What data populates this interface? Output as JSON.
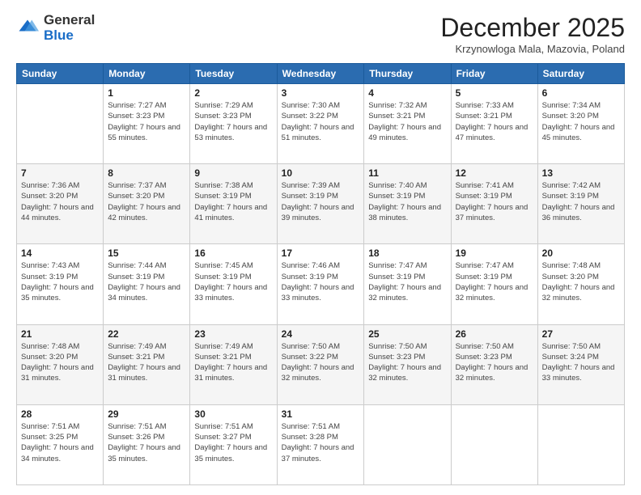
{
  "logo": {
    "general": "General",
    "blue": "Blue"
  },
  "header": {
    "month": "December 2025",
    "location": "Krzynowloga Mala, Mazovia, Poland"
  },
  "days_header": [
    "Sunday",
    "Monday",
    "Tuesday",
    "Wednesday",
    "Thursday",
    "Friday",
    "Saturday"
  ],
  "weeks": [
    [
      {
        "day": "",
        "sunrise": "",
        "sunset": "",
        "daylight": ""
      },
      {
        "day": "1",
        "sunrise": "Sunrise: 7:27 AM",
        "sunset": "Sunset: 3:23 PM",
        "daylight": "Daylight: 7 hours and 55 minutes."
      },
      {
        "day": "2",
        "sunrise": "Sunrise: 7:29 AM",
        "sunset": "Sunset: 3:23 PM",
        "daylight": "Daylight: 7 hours and 53 minutes."
      },
      {
        "day": "3",
        "sunrise": "Sunrise: 7:30 AM",
        "sunset": "Sunset: 3:22 PM",
        "daylight": "Daylight: 7 hours and 51 minutes."
      },
      {
        "day": "4",
        "sunrise": "Sunrise: 7:32 AM",
        "sunset": "Sunset: 3:21 PM",
        "daylight": "Daylight: 7 hours and 49 minutes."
      },
      {
        "day": "5",
        "sunrise": "Sunrise: 7:33 AM",
        "sunset": "Sunset: 3:21 PM",
        "daylight": "Daylight: 7 hours and 47 minutes."
      },
      {
        "day": "6",
        "sunrise": "Sunrise: 7:34 AM",
        "sunset": "Sunset: 3:20 PM",
        "daylight": "Daylight: 7 hours and 45 minutes."
      }
    ],
    [
      {
        "day": "7",
        "sunrise": "Sunrise: 7:36 AM",
        "sunset": "Sunset: 3:20 PM",
        "daylight": "Daylight: 7 hours and 44 minutes."
      },
      {
        "day": "8",
        "sunrise": "Sunrise: 7:37 AM",
        "sunset": "Sunset: 3:20 PM",
        "daylight": "Daylight: 7 hours and 42 minutes."
      },
      {
        "day": "9",
        "sunrise": "Sunrise: 7:38 AM",
        "sunset": "Sunset: 3:19 PM",
        "daylight": "Daylight: 7 hours and 41 minutes."
      },
      {
        "day": "10",
        "sunrise": "Sunrise: 7:39 AM",
        "sunset": "Sunset: 3:19 PM",
        "daylight": "Daylight: 7 hours and 39 minutes."
      },
      {
        "day": "11",
        "sunrise": "Sunrise: 7:40 AM",
        "sunset": "Sunset: 3:19 PM",
        "daylight": "Daylight: 7 hours and 38 minutes."
      },
      {
        "day": "12",
        "sunrise": "Sunrise: 7:41 AM",
        "sunset": "Sunset: 3:19 PM",
        "daylight": "Daylight: 7 hours and 37 minutes."
      },
      {
        "day": "13",
        "sunrise": "Sunrise: 7:42 AM",
        "sunset": "Sunset: 3:19 PM",
        "daylight": "Daylight: 7 hours and 36 minutes."
      }
    ],
    [
      {
        "day": "14",
        "sunrise": "Sunrise: 7:43 AM",
        "sunset": "Sunset: 3:19 PM",
        "daylight": "Daylight: 7 hours and 35 minutes."
      },
      {
        "day": "15",
        "sunrise": "Sunrise: 7:44 AM",
        "sunset": "Sunset: 3:19 PM",
        "daylight": "Daylight: 7 hours and 34 minutes."
      },
      {
        "day": "16",
        "sunrise": "Sunrise: 7:45 AM",
        "sunset": "Sunset: 3:19 PM",
        "daylight": "Daylight: 7 hours and 33 minutes."
      },
      {
        "day": "17",
        "sunrise": "Sunrise: 7:46 AM",
        "sunset": "Sunset: 3:19 PM",
        "daylight": "Daylight: 7 hours and 33 minutes."
      },
      {
        "day": "18",
        "sunrise": "Sunrise: 7:47 AM",
        "sunset": "Sunset: 3:19 PM",
        "daylight": "Daylight: 7 hours and 32 minutes."
      },
      {
        "day": "19",
        "sunrise": "Sunrise: 7:47 AM",
        "sunset": "Sunset: 3:19 PM",
        "daylight": "Daylight: 7 hours and 32 minutes."
      },
      {
        "day": "20",
        "sunrise": "Sunrise: 7:48 AM",
        "sunset": "Sunset: 3:20 PM",
        "daylight": "Daylight: 7 hours and 32 minutes."
      }
    ],
    [
      {
        "day": "21",
        "sunrise": "Sunrise: 7:48 AM",
        "sunset": "Sunset: 3:20 PM",
        "daylight": "Daylight: 7 hours and 31 minutes."
      },
      {
        "day": "22",
        "sunrise": "Sunrise: 7:49 AM",
        "sunset": "Sunset: 3:21 PM",
        "daylight": "Daylight: 7 hours and 31 minutes."
      },
      {
        "day": "23",
        "sunrise": "Sunrise: 7:49 AM",
        "sunset": "Sunset: 3:21 PM",
        "daylight": "Daylight: 7 hours and 31 minutes."
      },
      {
        "day": "24",
        "sunrise": "Sunrise: 7:50 AM",
        "sunset": "Sunset: 3:22 PM",
        "daylight": "Daylight: 7 hours and 32 minutes."
      },
      {
        "day": "25",
        "sunrise": "Sunrise: 7:50 AM",
        "sunset": "Sunset: 3:23 PM",
        "daylight": "Daylight: 7 hours and 32 minutes."
      },
      {
        "day": "26",
        "sunrise": "Sunrise: 7:50 AM",
        "sunset": "Sunset: 3:23 PM",
        "daylight": "Daylight: 7 hours and 32 minutes."
      },
      {
        "day": "27",
        "sunrise": "Sunrise: 7:50 AM",
        "sunset": "Sunset: 3:24 PM",
        "daylight": "Daylight: 7 hours and 33 minutes."
      }
    ],
    [
      {
        "day": "28",
        "sunrise": "Sunrise: 7:51 AM",
        "sunset": "Sunset: 3:25 PM",
        "daylight": "Daylight: 7 hours and 34 minutes."
      },
      {
        "day": "29",
        "sunrise": "Sunrise: 7:51 AM",
        "sunset": "Sunset: 3:26 PM",
        "daylight": "Daylight: 7 hours and 35 minutes."
      },
      {
        "day": "30",
        "sunrise": "Sunrise: 7:51 AM",
        "sunset": "Sunset: 3:27 PM",
        "daylight": "Daylight: 7 hours and 35 minutes."
      },
      {
        "day": "31",
        "sunrise": "Sunrise: 7:51 AM",
        "sunset": "Sunset: 3:28 PM",
        "daylight": "Daylight: 7 hours and 37 minutes."
      },
      {
        "day": "",
        "sunrise": "",
        "sunset": "",
        "daylight": ""
      },
      {
        "day": "",
        "sunrise": "",
        "sunset": "",
        "daylight": ""
      },
      {
        "day": "",
        "sunrise": "",
        "sunset": "",
        "daylight": ""
      }
    ]
  ]
}
